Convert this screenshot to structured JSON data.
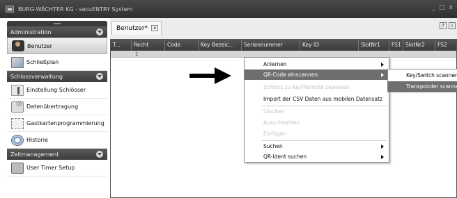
{
  "window": {
    "title": "BURG-WÄCHTER KG - secuENTRY System",
    "controls": [
      "_",
      "□",
      "x"
    ]
  },
  "sidebar": {
    "sections": [
      {
        "header": "Administration",
        "items": [
          {
            "label": "Benutzer",
            "icon": "user-icon",
            "active": true
          },
          {
            "label": "Schließplan",
            "icon": "locking-plan-icon"
          }
        ]
      },
      {
        "header": "Schlossverwaltung",
        "items": [
          {
            "label": "Einstellung Schlösser",
            "icon": "lock-settings-icon"
          },
          {
            "label": "Datenübertragung",
            "icon": "data-transfer-icon"
          },
          {
            "label": "Gastkartenprogrammierung",
            "icon": "guest-card-icon"
          },
          {
            "label": "Historie",
            "icon": "history-icon"
          }
        ]
      },
      {
        "header": "Zeitmanagement",
        "items": [
          {
            "label": "User Timer Setup",
            "icon": "timer-icon"
          }
        ]
      }
    ]
  },
  "main": {
    "tab": {
      "label": "Benutzer*",
      "close": "x"
    },
    "tools": [
      "?",
      "i"
    ],
    "grid": {
      "columns": [
        "T...",
        "Recht",
        "Code",
        "Key Bezeic...",
        "Seriennummer",
        "Key ID",
        "SlotNr1",
        "FS1",
        "SlotNr2",
        "FS2"
      ],
      "rows": [
        [
          "",
          "1",
          "",
          "",
          "",
          "",
          "",
          "",
          "",
          ""
        ]
      ]
    }
  },
  "context_menu": {
    "items": [
      {
        "label": "Anlernen",
        "submenu": true,
        "enabled": true
      },
      {
        "label": "QR-Code einscannen",
        "submenu": true,
        "enabled": true,
        "highlighted": true
      },
      {
        "label": "Schloss zu Key/Remote zuweisen",
        "enabled": false
      },
      {
        "label": "Import der CSV Daten aus mobilen Datensatz",
        "enabled": true
      },
      {
        "label": "Löschen",
        "enabled": false
      },
      {
        "label": "Ausschneiden",
        "enabled": false
      },
      {
        "label": "Einfügen",
        "enabled": false
      },
      {
        "label": "Suchen",
        "submenu": true,
        "enabled": true
      },
      {
        "label": "QR-Ident suchen",
        "submenu": true,
        "enabled": true
      }
    ]
  },
  "submenu": {
    "items": [
      {
        "label": "Key/Switch scannen"
      },
      {
        "label": "Transponder scannen",
        "highlighted": true
      }
    ]
  },
  "colors": {
    "titlebar": "#3a3a3a",
    "header_dark": "#444444",
    "highlight": "#6f6f6f",
    "disabled_text": "#c4c4c4"
  }
}
